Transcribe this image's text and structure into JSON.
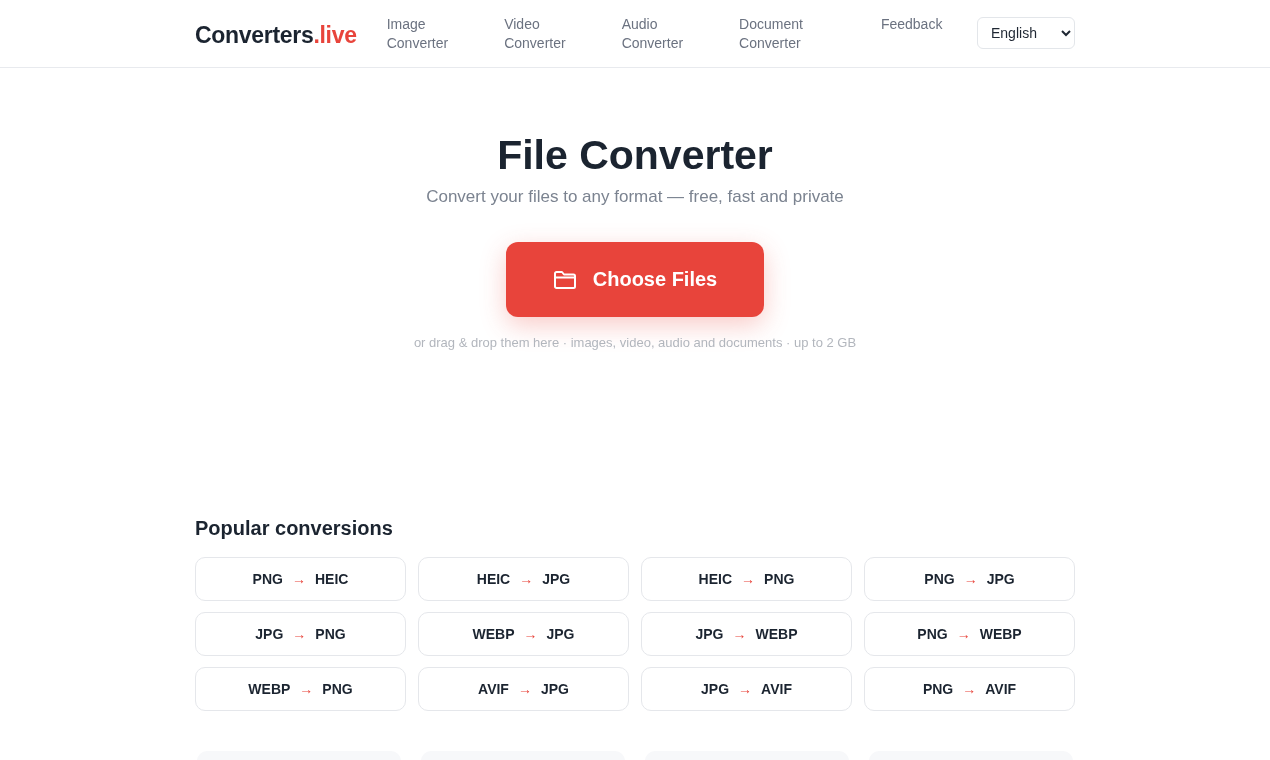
{
  "header": {
    "logo": {
      "name": "Converters",
      "accent": ".live"
    },
    "nav": [
      {
        "line1": "Image",
        "line2": "Converter"
      },
      {
        "line1": "Video",
        "line2": "Converter"
      },
      {
        "line1": "Audio",
        "line2": "Converter"
      },
      {
        "line1": "Document",
        "line2": "Converter"
      },
      {
        "line1": "Feedback"
      }
    ],
    "language_select": {
      "value": "English"
    }
  },
  "hero": {
    "title": "File Converter",
    "subtitle": "Convert your files to any format — free, fast and private",
    "button": "Choose Files",
    "hint": "or drag & drop them here · images, video, audio and documents · up to 2 GB"
  },
  "popular": {
    "title": "Popular conversions",
    "items": [
      {
        "from": "PNG",
        "arrow": "→",
        "to": "HEIC"
      },
      {
        "from": "HEIC",
        "arrow": "→",
        "to": "JPG"
      },
      {
        "from": "HEIC",
        "arrow": "→",
        "to": "PNG"
      },
      {
        "from": "PNG",
        "arrow": "→",
        "to": "JPG"
      },
      {
        "from": "JPG",
        "arrow": "→",
        "to": "PNG"
      },
      {
        "from": "WEBP",
        "arrow": "→",
        "to": "JPG"
      },
      {
        "from": "JPG",
        "arrow": "→",
        "to": "WEBP"
      },
      {
        "from": "PNG",
        "arrow": "→",
        "to": "WEBP"
      },
      {
        "from": "WEBP",
        "arrow": "→",
        "to": "PNG"
      },
      {
        "from": "AVIF",
        "arrow": "→",
        "to": "JPG"
      },
      {
        "from": "JPG",
        "arrow": "→",
        "to": "AVIF"
      },
      {
        "from": "PNG",
        "arrow": "→",
        "to": "AVIF"
      }
    ]
  }
}
